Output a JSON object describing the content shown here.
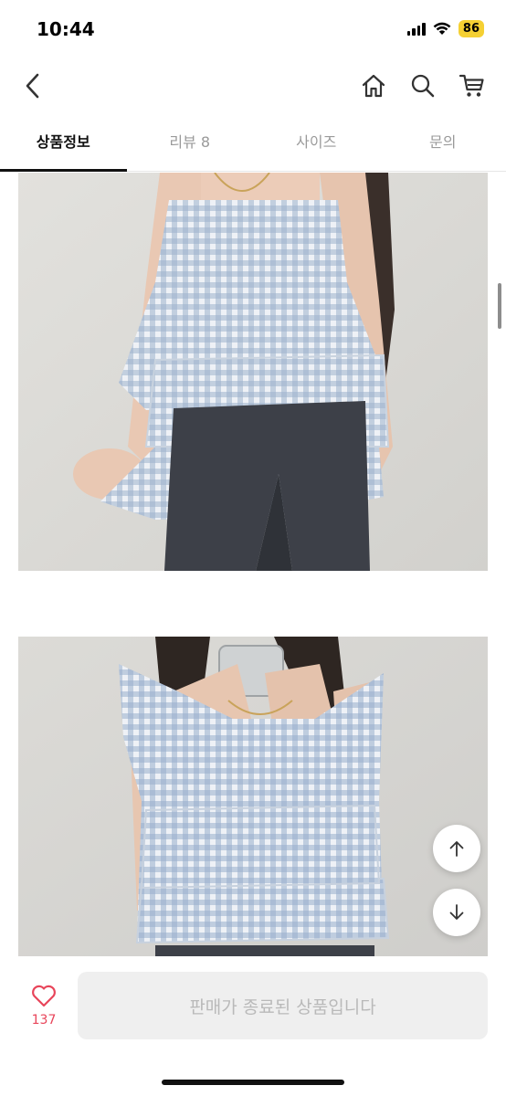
{
  "status": {
    "time": "10:44",
    "battery": "86"
  },
  "nav": {
    "icons": [
      "back-arrow-icon",
      "home-icon",
      "search-icon",
      "cart-icon"
    ]
  },
  "tabs": [
    {
      "label": "상품정보",
      "active": true
    },
    {
      "label": "리뷰 8",
      "active": false
    },
    {
      "label": "사이즈",
      "active": false
    },
    {
      "label": "문의",
      "active": false
    }
  ],
  "product_images": [
    "gingham-ruffle-top-photo-1",
    "gingham-ruffle-top-photo-2"
  ],
  "floating": {
    "icons": [
      "arrow-up-icon",
      "arrow-down-icon"
    ]
  },
  "bottom": {
    "like_count": "137",
    "sold_out_label": "판매가 종료된 상품입니다"
  },
  "colors": {
    "active_tab": "#111111",
    "inactive_tab": "#9a9a9a",
    "heart": "#e8455a",
    "battery": "#f5d033",
    "disabled_button_bg": "#efefef",
    "disabled_button_text": "#b9b9b9"
  }
}
